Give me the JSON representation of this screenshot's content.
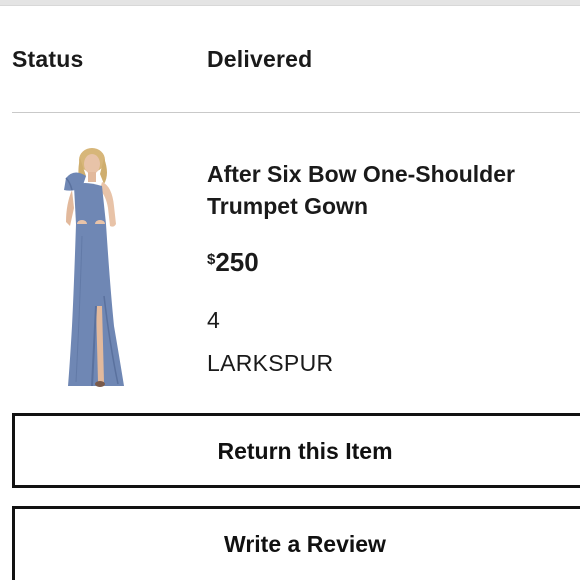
{
  "order": {
    "status_label": "Status",
    "status_value": "Delivered"
  },
  "product": {
    "title": "After Six Bow One-Shoulder Trumpet Gown",
    "price_currency": "$",
    "price_amount": "250",
    "size": "4",
    "color_name": "LARKSPUR",
    "image_icon": "gown-photo",
    "gown_color": "#6f87b4",
    "gown_shadow": "#5a719e",
    "skin_color": "#e8c3a8",
    "hair_color": "#d7b679"
  },
  "actions": {
    "return_label": "Return this Item",
    "review_label": "Write a Review"
  },
  "colors": {
    "text": "#1a1a1a",
    "divider": "#c9c9c9",
    "button_border": "#111111"
  }
}
